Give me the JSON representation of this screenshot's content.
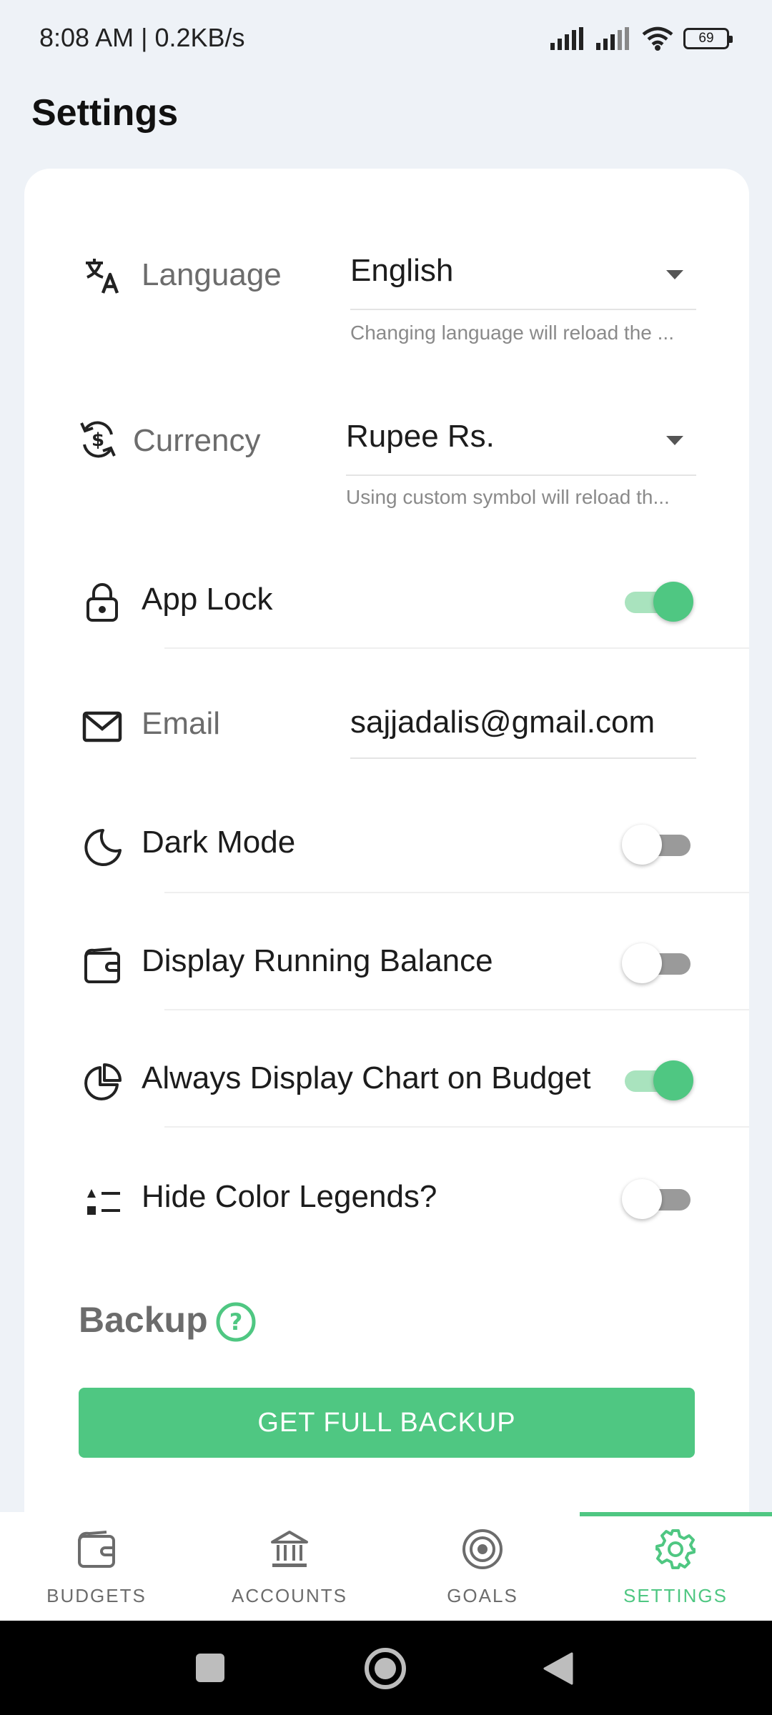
{
  "status_bar": {
    "time": "8:08 AM | 0.2KB/s",
    "battery": "69"
  },
  "page": {
    "title": "Settings"
  },
  "settings": {
    "language": {
      "label": "Language",
      "value": "English",
      "helper": "Changing language will reload the ..."
    },
    "currency": {
      "label": "Currency",
      "value": "Rupee Rs.",
      "helper": "Using custom symbol will reload th..."
    },
    "app_lock": {
      "label": "App Lock",
      "enabled": true
    },
    "email": {
      "label": "Email",
      "value": "sajjadalis@gmail.com"
    },
    "dark_mode": {
      "label": "Dark Mode",
      "enabled": false
    },
    "running_balance": {
      "label": "Display Running Balance",
      "enabled": false
    },
    "chart_on_budget": {
      "label": "Always Display Chart on Budget",
      "enabled": true
    },
    "hide_legends": {
      "label": "Hide Color Legends?",
      "enabled": false
    }
  },
  "backup": {
    "title": "Backup",
    "button_label": "GET FULL BACKUP"
  },
  "bottom_nav": {
    "items": [
      {
        "label": "BUDGETS",
        "icon": "wallet-icon"
      },
      {
        "label": "ACCOUNTS",
        "icon": "bank-icon"
      },
      {
        "label": "GOALS",
        "icon": "target-icon"
      },
      {
        "label": "SETTINGS",
        "icon": "gear-icon"
      }
    ],
    "active": "SETTINGS"
  },
  "colors": {
    "accent": "#4fc782",
    "accent_light": "#a9e3be",
    "background": "#eef2f7",
    "card": "#ffffff"
  }
}
